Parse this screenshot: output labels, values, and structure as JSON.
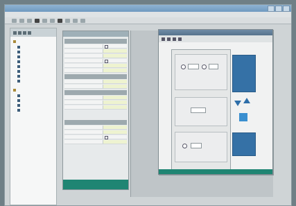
{
  "window": {
    "title": ""
  },
  "menu": {
    "items": [
      "",
      "",
      "",
      "",
      "",
      "",
      ""
    ]
  },
  "toolbar": {
    "buttons": 14
  },
  "tree": {
    "items": [
      "",
      "",
      "",
      "",
      "",
      "",
      "",
      "",
      "",
      "",
      "",
      "",
      "",
      "",
      ""
    ]
  },
  "properties": {
    "sections": [
      "",
      "",
      "",
      ""
    ],
    "rows": [
      "",
      "",
      "",
      "",
      "",
      "",
      "",
      "",
      "",
      "",
      "",
      "",
      "",
      "",
      ""
    ],
    "footer": ""
  },
  "editor": {
    "groups": [
      "",
      "",
      ""
    ]
  },
  "colors": {
    "accent_teal": "#1f8573",
    "accent_blue": "#3571a6",
    "title_blue": "#6e99c0"
  }
}
